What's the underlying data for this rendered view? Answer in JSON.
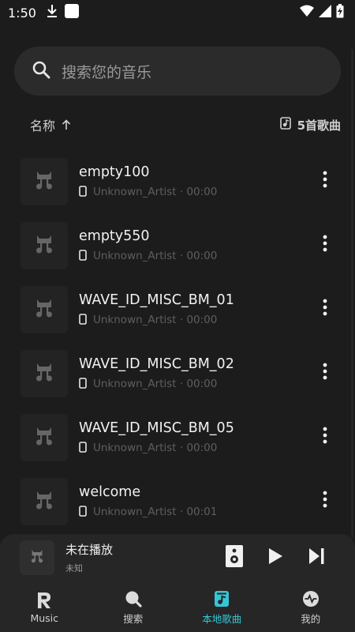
{
  "status_bar": {
    "time": "1:50",
    "left_icons": [
      "download-icon",
      "app-square-icon"
    ],
    "right_icons": [
      "wifi-icon",
      "signal-icon",
      "battery-charging-icon"
    ]
  },
  "search": {
    "placeholder": "搜索您的音乐"
  },
  "sort": {
    "label": "名称",
    "direction_icon": "arrow-up-icon",
    "count_label": "5首歌曲"
  },
  "songs": [
    {
      "title": "empty100",
      "meta": "Unknown_Artist · 00:00"
    },
    {
      "title": "empty550",
      "meta": "Unknown_Artist · 00:00"
    },
    {
      "title": "WAVE_ID_MISC_BM_01",
      "meta": "Unknown_Artist · 00:00"
    },
    {
      "title": "WAVE_ID_MISC_BM_02",
      "meta": "Unknown_Artist · 00:00"
    },
    {
      "title": "WAVE_ID_MISC_BM_05",
      "meta": "Unknown_Artist · 00:00"
    },
    {
      "title": "welcome",
      "meta": "Unknown_Artist · 00:01"
    }
  ],
  "mini_player": {
    "title": "未在播放",
    "subtitle": "未知"
  },
  "nav": [
    {
      "label": "Music",
      "icon": "r-logo-icon",
      "active": false
    },
    {
      "label": "搜索",
      "icon": "search-icon",
      "active": false
    },
    {
      "label": "本地歌曲",
      "icon": "music-file-icon",
      "active": true
    },
    {
      "label": "我的",
      "icon": "profile-icon",
      "active": false
    }
  ],
  "colors": {
    "background": "#1c1c1c",
    "surface": "#262626",
    "accent": "#35c6d6"
  }
}
